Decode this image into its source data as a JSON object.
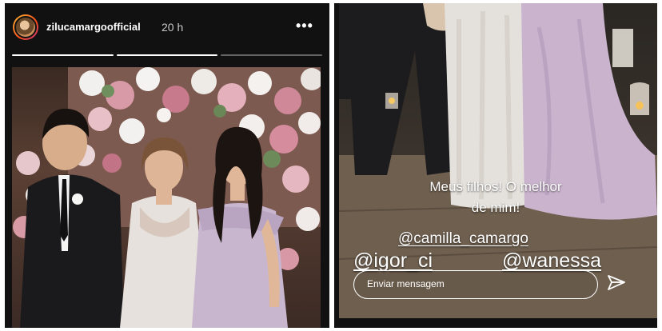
{
  "left_story": {
    "username": "zilucamargoofficial",
    "time_ago": "20 h",
    "more_glyph": "•••",
    "progress": {
      "segments": 3,
      "completed": 2
    }
  },
  "right_story": {
    "caption_line1": "Meus filhos! O melhor",
    "caption_line2": "de mim!",
    "mentions": [
      "@camilla_camargo",
      "@igor_ci",
      "@wanessa"
    ],
    "reply_placeholder": "Enviar mensagem"
  },
  "colors": {
    "story_background": "#111111",
    "text": "#ffffff"
  },
  "icons": {
    "more": "more-options-icon",
    "send": "send-icon"
  }
}
